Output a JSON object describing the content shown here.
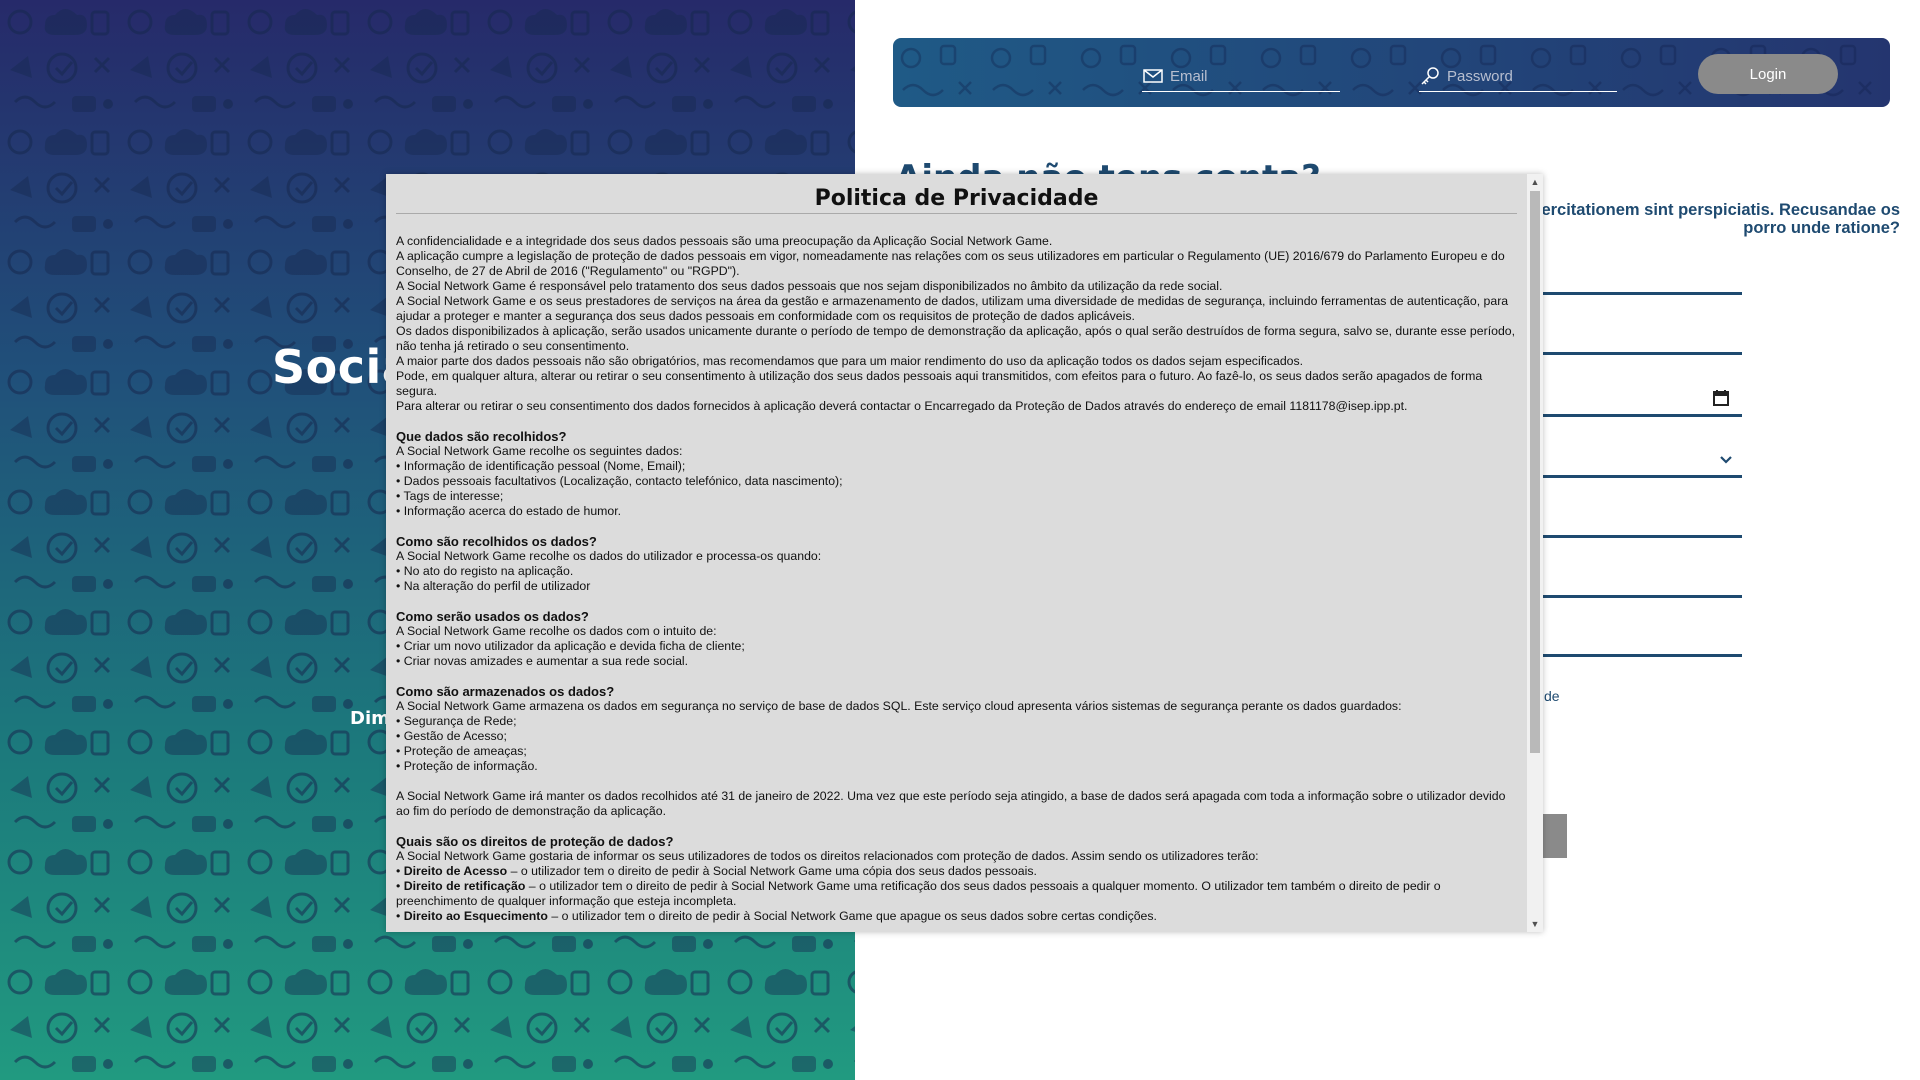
{
  "left_panel": {
    "title": "Social Network Game",
    "subtitle": "Dimensão"
  },
  "login": {
    "email_placeholder": "Email",
    "password_placeholder": "Password",
    "login_label": "Login"
  },
  "registration": {
    "heading": "Ainda não tens conta?",
    "description": "exercitationem sint perspiciatis. Recusandae os porro unde ratione?",
    "consent_fragment": "de"
  },
  "modal": {
    "title": "Politica de Privacidade",
    "intro": [
      "A confidencialidade e a integridade dos seus dados pessoais são uma preocupação da Aplicação Social Network Game.",
      "A aplicação cumpre a legislação de proteção de dados pessoais em vigor, nomeadamente nas relações com os seus utilizadores em particular o Regulamento (UE) 2016/679 do Parlamento Europeu e do Conselho, de 27 de Abril de 2016 (\"Regulamento\" ou \"RGPD\").",
      "A Social Network Game é responsável pelo tratamento dos seus dados pessoais que nos sejam disponibilizados no âmbito da utilização da rede social.",
      "A Social Network Game e os seus prestadores de serviços na área da gestão e armazenamento de dados, utilizam uma diversidade de medidas de segurança, incluindo ferramentas de autenticação, para ajudar a proteger e manter a segurança dos seus dados pessoais em conformidade com os requisitos de proteção de dados aplicáveis.",
      "Os dados disponibilizados à aplicação, serão usados unicamente durante o período de tempo de demonstração da aplicação, após o qual serão destruídos de forma segura, salvo se, durante esse período, não tenha já retirado o seu consentimento.",
      "A maior parte dos dados pessoais não são obrigatórios, mas recomendamos que para um maior rendimento do uso da aplicação todos os dados sejam especificados.",
      "Pode, em qualquer altura, alterar ou retirar o seu consentimento à utilização dos seus dados pessoais aqui transmitidos, com efeitos para o futuro. Ao fazê-lo, os seus dados serão apagados de forma segura.",
      "Para alterar ou retirar o seu consentimento dos dados fornecidos à aplicação deverá contactar o Encarregado da Proteção de Dados através do endereço de email 1181178@isep.ipp.pt."
    ],
    "sections": [
      {
        "title": "Que dados são recolhidos?",
        "lines": [
          "A Social Network Game recolhe os seguintes dados:",
          "• Informação de identificação pessoal (Nome, Email);",
          "• Dados pessoais facultativos (Localização, contacto telefónico, data nascimento);",
          "• Tags de interesse;",
          "• Informação acerca do estado de humor."
        ]
      },
      {
        "title": "Como são recolhidos os dados?",
        "lines": [
          "A Social Network Game recolhe os dados do utilizador e processa-os quando:",
          "• No ato do registo na aplicação.",
          "• Na alteração do perfil de utilizador"
        ]
      },
      {
        "title": "Como serão usados os dados?",
        "lines": [
          "A Social Network Game recolhe os dados com o intuito de:",
          "• Criar um novo utilizador da aplicação e devida ficha de cliente;",
          "• Criar novas amizades e aumentar a sua rede social."
        ]
      },
      {
        "title": "Como são armazenados os dados?",
        "lines": [
          "A Social Network Game armazena os dados em segurança no serviço de base de dados SQL. Este serviço cloud apresenta vários sistemas de segurança perante os dados guardados:",
          "• Segurança de Rede;",
          "• Gestão de Acesso;",
          "• Proteção de ameaças;",
          "• Proteção de informação."
        ],
        "after": "A Social Network Game irá manter os dados recolhidos até 31 de janeiro de 2022. Uma vez que este período seja atingido, a base de dados será apagada com toda a informação sobre o utilizador devido ao fim do período de demonstração da aplicação."
      }
    ],
    "rights": {
      "title": "Quais são os direitos de proteção de dados?",
      "intro": "A Social Network Game gostaria de informar os seus utilizadores de todos os direitos relacionados com proteção de dados. Assim sendo os utilizadores terão:",
      "items": [
        {
          "term": "Direito de Acesso",
          "text": " – o utilizador tem o direito de pedir à Social Network Game uma cópia dos seus dados pessoais."
        },
        {
          "term": "Direito de retificação",
          "text": " – o utilizador tem o direito de pedir à Social Network Game uma retificação dos seus dados pessoais a qualquer momento. O utilizador tem também o direito de pedir o preenchimento de qualquer informação que esteja incompleta."
        },
        {
          "term": "Direito ao Esquecimento",
          "text": " – o utilizador tem o direito de pedir à Social Network Game que apague os seus dados sobre certas condições."
        }
      ]
    }
  },
  "colors": {
    "navy": "#1e4a70",
    "modal_bg": "#dcdcdc",
    "button_gray": "#8a8a8a"
  }
}
